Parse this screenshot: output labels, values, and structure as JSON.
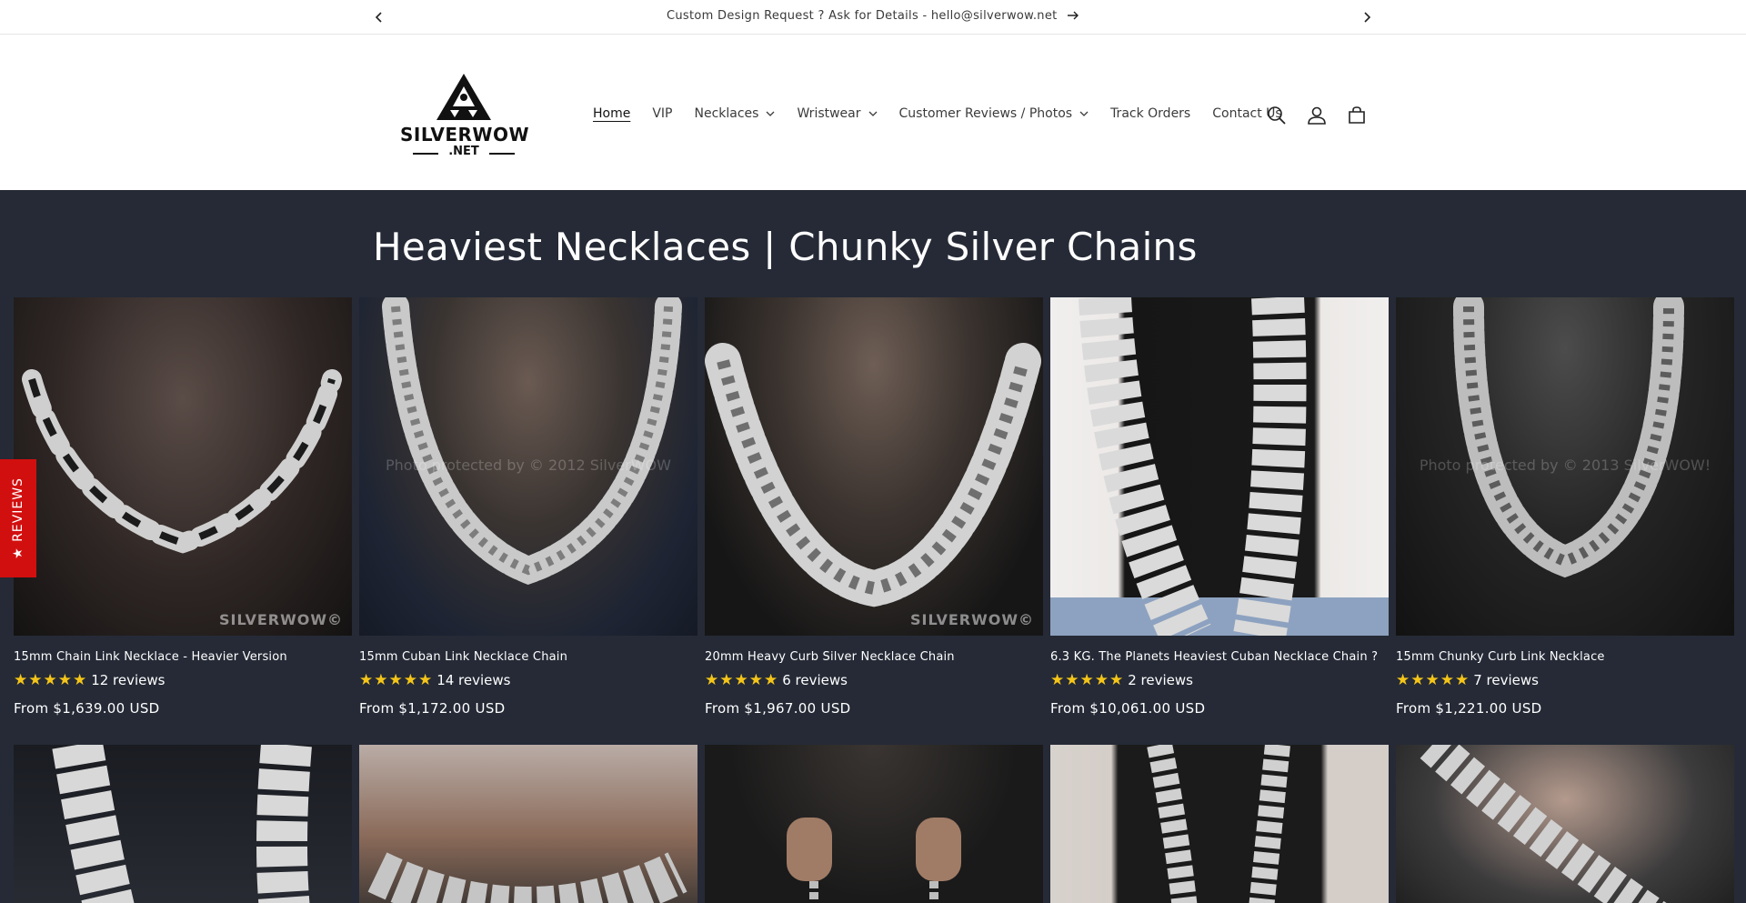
{
  "announcement": {
    "text": "Custom Design Request ? Ask for Details - hello@silverwow.net"
  },
  "logo": {
    "wordmark": "SILVERWOW",
    "sub": ".NET"
  },
  "nav": {
    "items": [
      {
        "label": "Home",
        "active": true,
        "dropdown": false
      },
      {
        "label": "VIP",
        "active": false,
        "dropdown": false
      },
      {
        "label": "Necklaces",
        "active": false,
        "dropdown": true
      },
      {
        "label": "Wristwear",
        "active": false,
        "dropdown": true
      },
      {
        "label": "Customer Reviews / Photos",
        "active": false,
        "dropdown": true
      },
      {
        "label": "Track Orders",
        "active": false,
        "dropdown": false
      },
      {
        "label": "Contact Us",
        "active": false,
        "dropdown": false
      }
    ]
  },
  "header_icons": [
    "search-icon",
    "account-icon",
    "cart-icon"
  ],
  "collection": {
    "title": "Heaviest Necklaces | Chunky Silver Chains"
  },
  "reviews_tab": {
    "label": "★ REVIEWS"
  },
  "products": [
    {
      "title": "15mm Chain Link Necklace - Heavier Version",
      "stars": "★★★★★",
      "reviews": "12 reviews",
      "price": "From $1,639.00 USD",
      "watermark": "",
      "brand_watermark": "SILVERWOW©"
    },
    {
      "title": "15mm Cuban Link Necklace Chain",
      "stars": "★★★★★",
      "reviews": "14 reviews",
      "price": "From $1,172.00 USD",
      "watermark": "Photo protected by © 2012 SilverWOW",
      "brand_watermark": ""
    },
    {
      "title": "20mm Heavy Curb Silver Necklace Chain",
      "stars": "★★★★★",
      "reviews": "6 reviews",
      "price": "From $1,967.00 USD",
      "watermark": "",
      "brand_watermark": "SILVERWOW©"
    },
    {
      "title": "6.3 KG. The Planets Heaviest Cuban Necklace Chain ?",
      "stars": "★★★★★",
      "reviews": "2 reviews",
      "price": "From $10,061.00 USD",
      "watermark": "",
      "brand_watermark": ""
    },
    {
      "title": "15mm Chunky Curb Link Necklace",
      "stars": "★★★★★",
      "reviews": "7 reviews",
      "price": "From $1,221.00 USD",
      "watermark": "Photo protected by © 2013 SilverWOW!",
      "brand_watermark": ""
    }
  ],
  "colors": {
    "collection_bg": "#252a36",
    "star": "#f5c518",
    "reviews_tab": "#d20f0f"
  }
}
